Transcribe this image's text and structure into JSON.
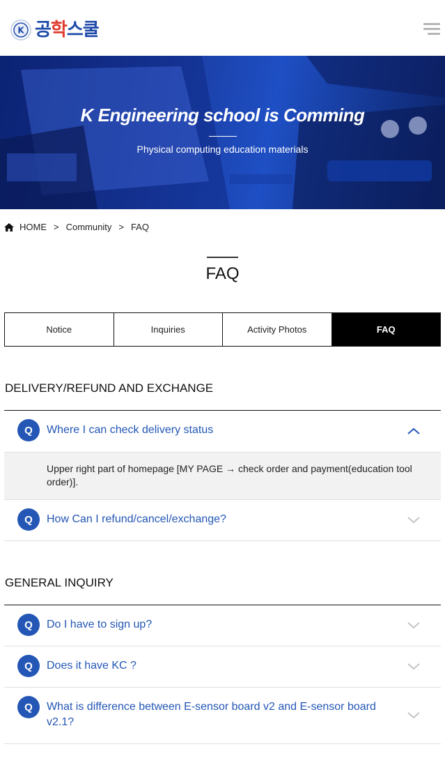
{
  "brand": {
    "logo_text_k": "K",
    "logo_text_a": "공",
    "logo_text_b": "학",
    "logo_text_c": "스쿨"
  },
  "hero": {
    "title": "K Engineering school is Comming",
    "subtitle": "Physical computing education materials"
  },
  "breadcrumb": {
    "home": "HOME",
    "sep": ">",
    "level1": "Community",
    "level2": "FAQ"
  },
  "page_title": "FAQ",
  "tabs": [
    {
      "label": "Notice",
      "active": false
    },
    {
      "label": "Inquiries",
      "active": false
    },
    {
      "label": "Activity Photos",
      "active": false
    },
    {
      "label": "FAQ",
      "active": true
    }
  ],
  "sections": [
    {
      "title": "DELIVERY/REFUND AND EXCHANGE",
      "items": [
        {
          "badge": "Q",
          "question": "Where I can check delivery status",
          "expanded": true,
          "answer": "Upper right part of homepage [MY PAGE → check order and payment(education tool order)]."
        },
        {
          "badge": "Q",
          "question": "How Can I refund/cancel/exchange?",
          "expanded": false
        }
      ]
    },
    {
      "title": "GENERAL INQUIRY",
      "items": [
        {
          "badge": "Q",
          "question": "Do I have to sign up?",
          "expanded": false
        },
        {
          "badge": "Q",
          "question": "Does it have KC ?",
          "expanded": false
        },
        {
          "badge": "Q",
          "question": "What is difference between E-sensor board v2 and E-sensor board v2.1?",
          "expanded": false
        }
      ]
    }
  ],
  "colors": {
    "accent": "#2356b5",
    "brand_blue": "#1e4aa8",
    "brand_red": "#e03a2f",
    "tab_active_bg": "#000000"
  },
  "icons": {
    "menu": "hamburger-menu-icon",
    "home": "home-icon",
    "expanded": "chevron-up-icon",
    "collapsed": "chevron-down-icon"
  }
}
